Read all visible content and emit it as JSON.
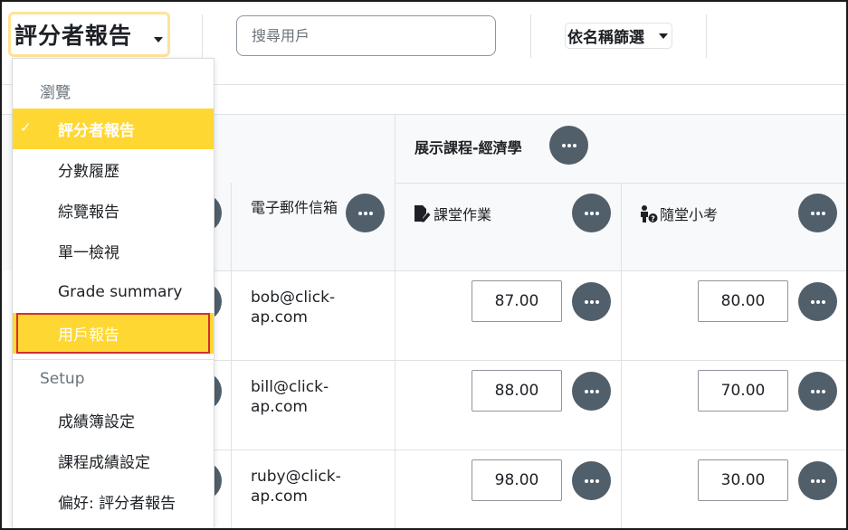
{
  "header": {
    "report_selector_label": "評分者報告",
    "search_placeholder": "搜尋用戶",
    "name_filter_label": "依名稱篩選"
  },
  "table": {
    "course_title": "展示課程-經濟學",
    "columns": {
      "email": "電子郵件信箱",
      "assignment": "課堂作業",
      "quiz": "隨堂小考"
    },
    "rows": [
      {
        "email": "bob@click-ap.com",
        "assignment": "87.00",
        "quiz": "80.00"
      },
      {
        "email": "bill@click-ap.com",
        "assignment": "88.00",
        "quiz": "70.00"
      },
      {
        "email": "ruby@click-ap.com",
        "assignment": "98.00",
        "quiz": "30.00"
      }
    ]
  },
  "menu": {
    "section_view": "瀏覽",
    "section_setup": "Setup",
    "items": [
      {
        "label": "評分者報告",
        "state": "active"
      },
      {
        "label": "分數履歷"
      },
      {
        "label": "綜覽報告"
      },
      {
        "label": "單一檢視"
      },
      {
        "label": "Grade summary"
      },
      {
        "label": "用戶報告",
        "state": "highlighted"
      }
    ],
    "setup_items": [
      {
        "label": "成績簿設定"
      },
      {
        "label": "課程成績設定"
      },
      {
        "label": "偏好: 評分者報告"
      }
    ]
  },
  "colors": {
    "accent_yellow": "#ffd733",
    "focus_border": "#ffe299",
    "action_button": "#515f6b",
    "annotation_red": "#d32f2f"
  }
}
